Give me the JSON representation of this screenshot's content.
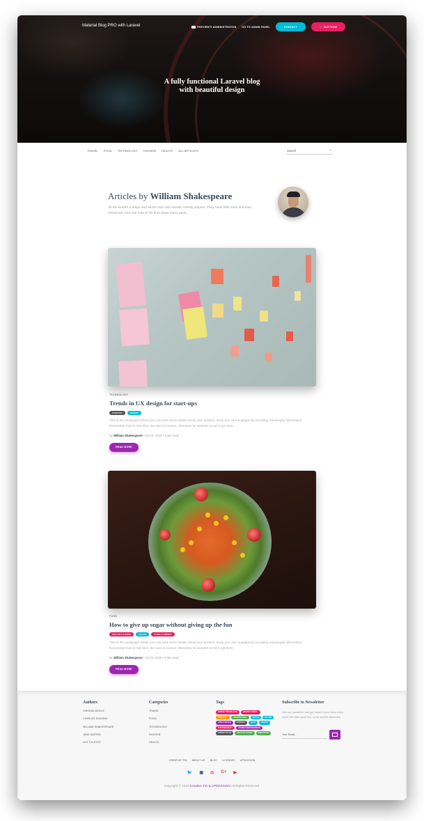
{
  "header": {
    "brand": "Material Blog PRO with Laravel",
    "docs_link": "PREVIEW'S ADMINISTRATION",
    "admin_link": "GO TO ADMIN PANEL",
    "contact_label": "CONTACT",
    "buy_label": "BUY NOW",
    "hero_title_line1": "A fully functional Laravel blog",
    "hero_title_line2": "with beautiful design"
  },
  "nav": {
    "items": [
      "TRAVEL",
      "FOOD",
      "TECHNOLOGY",
      "FASHION",
      "HEALTH",
      "ALL ARTICLES"
    ],
    "search_placeholder": "Search"
  },
  "author": {
    "title_prefix": "Articles by",
    "name": "William Shakespeare",
    "bio": "All the world's a stage and all the men and women merely players. They have their exits and their entrances; And one man in his time plays many parts."
  },
  "posts": [
    {
      "category": "TECHNOLOGY",
      "title": "Trends in UX design for start-ups",
      "tags": [
        {
          "label": "STARTUP",
          "color": "#555555"
        },
        {
          "label": "DESIGN",
          "color": "#00bcd4"
        }
      ],
      "excerpt": "This is the paragraph where you can write more details about your product. Keep you user engaged by providing meaningful information. Remember that by this time, the user is curious, otherwise he wouldn't scroll to get here.",
      "author_prefix": "By",
      "author": "William Shakespeare",
      "date": "Oct 31, 2019 • 4 min read",
      "read_more": "READ MORE"
    },
    {
      "category": "FOOD",
      "title": "How to give up sugar without giving up the fun",
      "tags": [
        {
          "label": "HEALTHY EATING",
          "color": "#e91e63"
        },
        {
          "label": "VEGAN",
          "color": "#00bcd4"
        },
        {
          "label": "FOOD & DRINKS",
          "color": "#e91e63"
        }
      ],
      "excerpt": "This is the paragraph where you can write more details about your product. Keep you user engaged by providing meaningful information. Remember that by this time, the user is curious, otherwise he wouldn't scroll to get here.",
      "author_prefix": "By",
      "author": "William Shakespeare",
      "date": "Oct 31, 2019 • 4 min read",
      "read_more": "READ MORE"
    }
  ],
  "footer": {
    "authors_title": "Authors",
    "authors": [
      "VIRGINIA WOOLF",
      "CHARLES DICKENS",
      "WILLIAM SHAKESPEARE",
      "JANE AUSTEN",
      "LEO TOLSTOY"
    ],
    "categories_title": "Categories",
    "categories": [
      "TRAVEL",
      "FOOD",
      "TECHNOLOGY",
      "FASHION",
      "HEALTH"
    ],
    "tags_title": "Tags",
    "tags": [
      {
        "label": "BUDGET TRAVELLING",
        "color": "#e91e63"
      },
      {
        "label": "HOLIDAY DESTI...",
        "color": "#e91e63"
      },
      {
        "label": "SPECIALTY",
        "color": "#ff9800"
      },
      {
        "label": "DESTINATIONS",
        "color": "#4caf50"
      },
      {
        "label": "VEGAN",
        "color": "#00bcd4"
      },
      {
        "label": "NATURE",
        "color": "#00bcd4"
      },
      {
        "label": "APPLE WATCH",
        "color": "#9c27b0"
      },
      {
        "label": "STARTUP",
        "color": "#555555"
      },
      {
        "label": "TECH",
        "color": "#00bcd4"
      },
      {
        "label": "DESIGN",
        "color": "#00bcd4"
      },
      {
        "label": "SUSTAINABILITY",
        "color": "#e91e63"
      },
      {
        "label": "WOMEN EMPOWERMENT",
        "color": "#9c27b0"
      },
      {
        "label": "STREET STYLE",
        "color": "#555555"
      },
      {
        "label": "HEALTHY EATING",
        "color": "#4caf50"
      },
      {
        "label": "MEDITATION",
        "color": "#4caf50"
      }
    ],
    "newsletter_title": "Subscribe to Newsletter",
    "newsletter_text": "Join our newsletter and get news in your inbox every week! We hate spam too, so no worries about this.",
    "email_placeholder": "Your Email...",
    "links": [
      "CREATIVE TIM",
      "ABOUT US",
      "BLOG",
      "LICENSES",
      "UPDIVISION"
    ],
    "copyright_prefix": "Copyright © 2019",
    "copyright_links": "Creative Tim & UPDIVISION",
    "copyright_suffix": "All Rights Reserved.",
    "social_icons": [
      "twitter-icon",
      "facebook-icon",
      "instagram-icon",
      "google-plus-icon",
      "youtube-icon"
    ],
    "colors": {
      "accent": "#9c27b0",
      "contact": "#00bcd4",
      "buy": "#e91e63"
    }
  }
}
